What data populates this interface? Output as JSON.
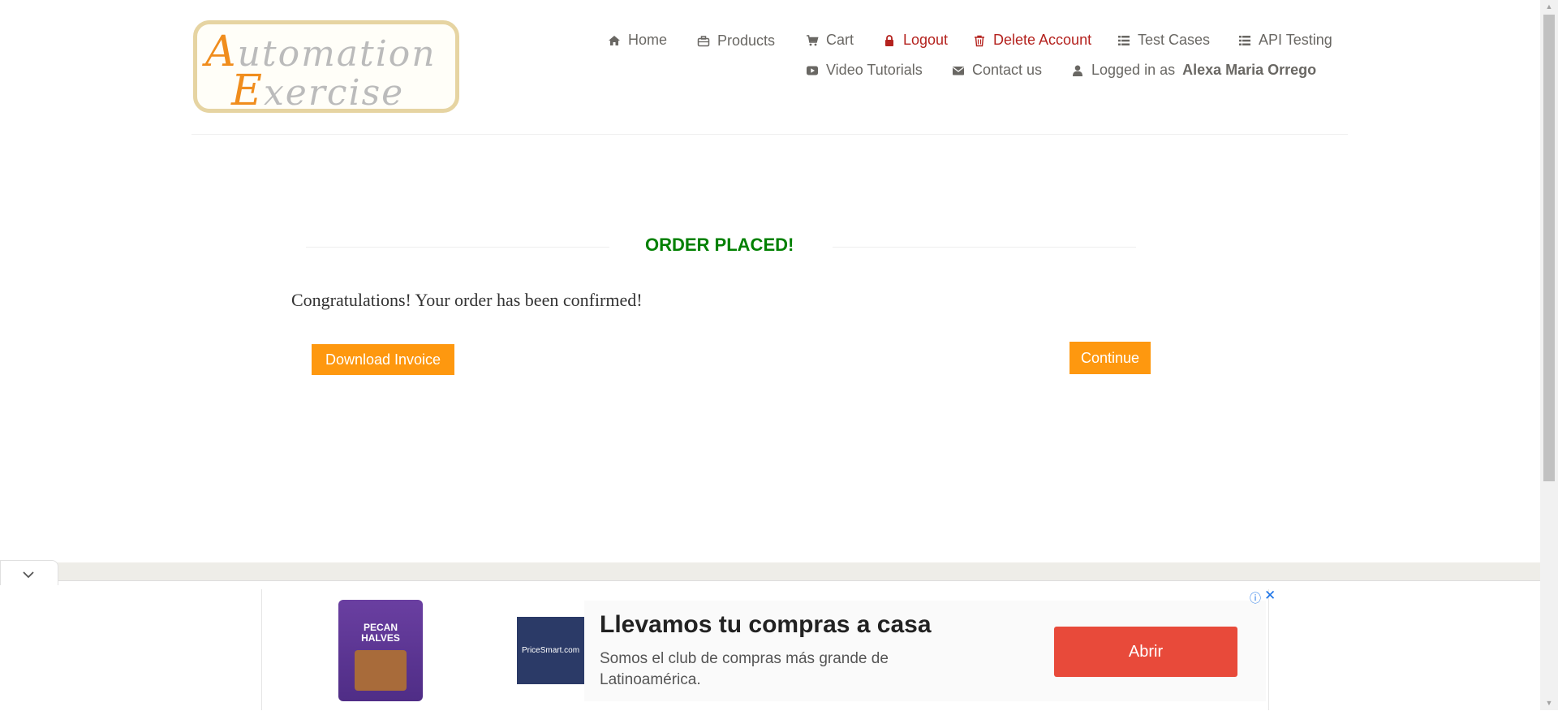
{
  "logo": {
    "line1_cap": "A",
    "line1_rest": "utomation",
    "line2_cap": "E",
    "line2_rest": "xercise"
  },
  "nav": {
    "home": "Home",
    "products": "Products",
    "cart": "Cart",
    "logout": "Logout",
    "delete_account": "Delete Account",
    "test_cases": "Test Cases",
    "api_testing": "API Testing",
    "video_tutorials": "Video Tutorials",
    "contact_us": "Contact us",
    "logged_in_prefix": "Logged in as",
    "logged_in_user": "Alexa Maria Orrego"
  },
  "main": {
    "title": "ORDER PLACED!",
    "message": "Congratulations! Your order has been confirmed!",
    "download_invoice": "Download Invoice",
    "continue": "Continue"
  },
  "ad": {
    "product_label": "PECAN HALVES",
    "brand": "PriceSmart.com",
    "headline": "Llevamos tu compras a casa",
    "subtext": "Somos el club de compras más grande de Latinoamérica.",
    "cta": "Abrir"
  },
  "colors": {
    "accent": "#fe980f",
    "success": "#008000",
    "danger": "#b4221e",
    "ad_cta": "#e84a3a"
  }
}
